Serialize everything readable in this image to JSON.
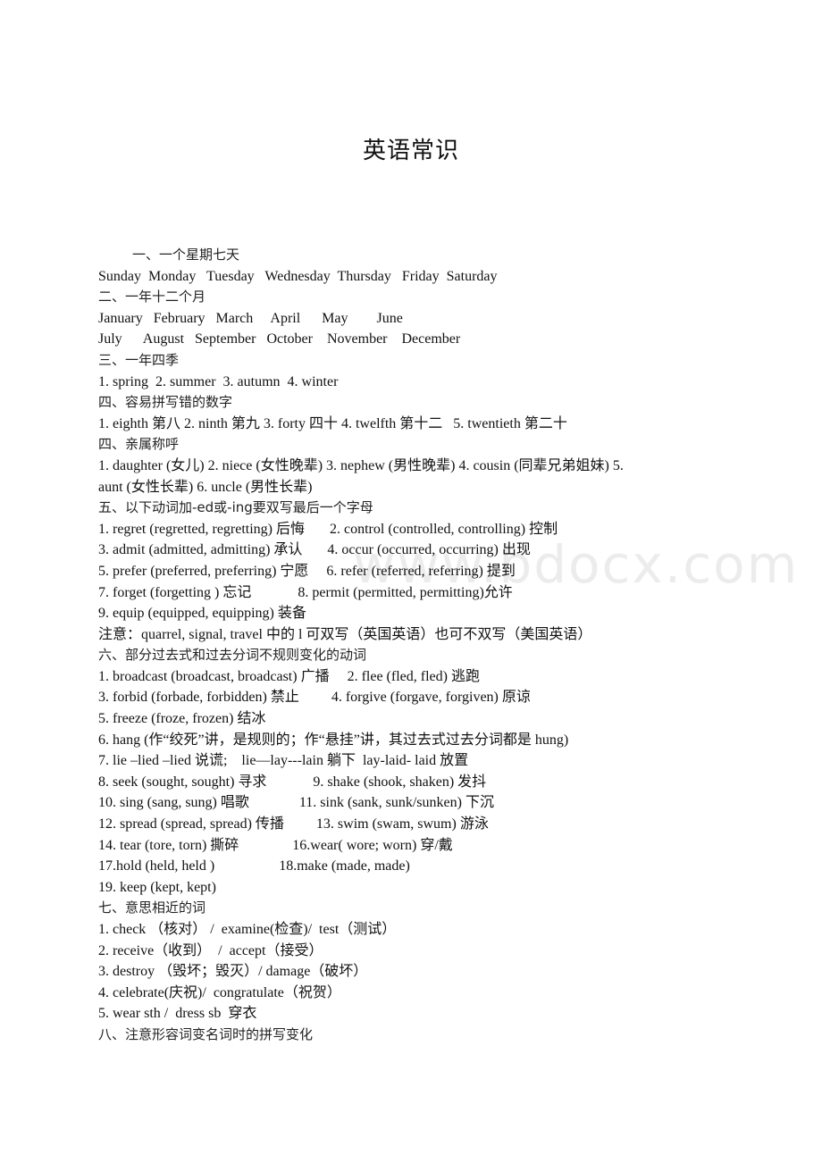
{
  "title": "英语常识",
  "watermark": "www.bdocx.com",
  "lines": [
    {
      "type": "heading",
      "indent": true,
      "text": "一、一个星期七天"
    },
    {
      "type": "text",
      "text": "Sunday  Monday   Tuesday   Wednesday  Thursday   Friday  Saturday"
    },
    {
      "type": "heading",
      "text": "二、一年十二个月"
    },
    {
      "type": "text",
      "text": "January   February   March     April      May        June"
    },
    {
      "type": "text",
      "text": "July      August   September   October    November    December"
    },
    {
      "type": "heading",
      "text": "三、一年四季"
    },
    {
      "type": "text",
      "text": "1. spring  2. summer  3. autumn  4. winter"
    },
    {
      "type": "heading",
      "text": "四、容易拼写错的数字"
    },
    {
      "type": "text",
      "text": "1. eighth 第八 2. ninth 第九 3. forty 四十 4. twelfth 第十二   5. twentieth 第二十"
    },
    {
      "type": "heading",
      "text": "四、亲属称呼"
    },
    {
      "type": "text",
      "text": "1. daughter (女儿) 2. niece (女性晚辈) 3. nephew (男性晚辈) 4. cousin (同辈兄弟姐妹) 5."
    },
    {
      "type": "text",
      "text": "aunt (女性长辈) 6. uncle (男性长辈)"
    },
    {
      "type": "heading",
      "text": "五、以下动词加-ed或-ing要双写最后一个字母"
    },
    {
      "type": "text",
      "text": "1. regret (regretted, regretting) 后悔       2. control (controlled, controlling) 控制"
    },
    {
      "type": "text",
      "text": "3. admit (admitted, admitting) 承认       4. occur (occurred, occurring) 出现"
    },
    {
      "type": "text",
      "text": "5. prefer (preferred, preferring) 宁愿     6. refer (referred, referring) 提到"
    },
    {
      "type": "text",
      "text": "7. forget (forgetting ) 忘记             8. permit (permitted, permitting)允许"
    },
    {
      "type": "text",
      "text": "9. equip (equipped, equipping) 装备"
    },
    {
      "type": "text",
      "text": "注意：quarrel, signal, travel 中的 l 可双写（英国英语）也可不双写（美国英语）"
    },
    {
      "type": "heading",
      "text": "六、部分过去式和过去分词不规则变化的动词"
    },
    {
      "type": "text",
      "text": "1. broadcast (broadcast, broadcast) 广播     2. flee (fled, fled) 逃跑"
    },
    {
      "type": "text",
      "text": "3. forbid (forbade, forbidden) 禁止         4. forgive (forgave, forgiven) 原谅"
    },
    {
      "type": "text",
      "text": "5. freeze (froze, frozen) 结冰"
    },
    {
      "type": "text",
      "text": "6. hang (作“绞死”讲，是规则的；作“悬挂”讲，其过去式过去分词都是 hung)"
    },
    {
      "type": "text",
      "text": "7. lie –lied –lied 说谎;    lie—lay---lain 躺下  lay-laid- laid 放置"
    },
    {
      "type": "text",
      "text": "8. seek (sought, sought) 寻求             9. shake (shook, shaken) 发抖"
    },
    {
      "type": "text",
      "text": "10. sing (sang, sung) 唱歌              11. sink (sank, sunk/sunken) 下沉"
    },
    {
      "type": "text",
      "text": "12. spread (spread, spread) 传播         13. swim (swam, swum) 游泳"
    },
    {
      "type": "text",
      "text": "14. tear (tore, torn) 撕碎               16.wear( wore; worn) 穿/戴"
    },
    {
      "type": "text",
      "text": "17.hold (held, held )                  18.make (made, made)"
    },
    {
      "type": "text",
      "text": "19. keep (kept, kept)"
    },
    {
      "type": "heading",
      "text": "七、意思相近的词"
    },
    {
      "type": "text",
      "text": "1. check （核对） /  examine(检查)/  test（测试）"
    },
    {
      "type": "text",
      "text": "2. receive（收到）  /  accept（接受）"
    },
    {
      "type": "text",
      "text": "3. destroy （毁坏；毁灭）/ damage（破坏）"
    },
    {
      "type": "text",
      "text": "4. celebrate(庆祝)/  congratulate（祝贺）"
    },
    {
      "type": "text",
      "text": "5. wear sth /  dress sb  穿衣"
    },
    {
      "type": "heading",
      "text": "八、注意形容词变名词时的拼写变化"
    }
  ]
}
